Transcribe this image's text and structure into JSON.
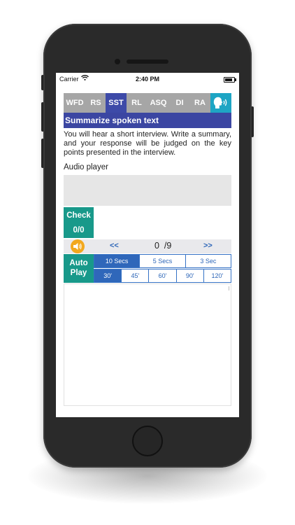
{
  "status_bar": {
    "carrier": "Carrier",
    "time": "2:40 PM"
  },
  "tabs": [
    {
      "label": "WFD",
      "active": false
    },
    {
      "label": "RS",
      "active": false
    },
    {
      "label": "SST",
      "active": true
    },
    {
      "label": "RL",
      "active": false
    },
    {
      "label": "ASQ",
      "active": false
    },
    {
      "label": "DI",
      "active": false
    },
    {
      "label": "RA",
      "active": false
    }
  ],
  "tab_speech_icon": "speaking-head-icon",
  "section": {
    "title": "Summarize spoken text",
    "instructions": "You will hear a short interview. Write a summary, and your response will be judged on the key points presented in the interview."
  },
  "audio": {
    "label": "Audio player"
  },
  "check": {
    "label": "Check",
    "score": "0/0"
  },
  "navigation": {
    "speaker_icon": "speaker-icon",
    "prev_label": "<<",
    "counter": "0  /9",
    "next_label": ">>"
  },
  "autoplay": {
    "line1": "Auto",
    "line2": "Play"
  },
  "delay_options": [
    {
      "label": "10 Secs",
      "selected": true
    },
    {
      "label": "5 Secs",
      "selected": false
    },
    {
      "label": "3 Sec",
      "selected": false
    }
  ],
  "duration_options": [
    {
      "label": "30'",
      "selected": true
    },
    {
      "label": "45'",
      "selected": false
    },
    {
      "label": "60'",
      "selected": false
    },
    {
      "label": "90'",
      "selected": false
    },
    {
      "label": "120'",
      "selected": false
    }
  ],
  "colors": {
    "tab_bar": "#a6a6a6",
    "tab_active": "#3d4aa8",
    "title_bar": "#3b46a2",
    "teal_button": "#18998a",
    "segment_blue": "#2f67ba",
    "speaker_orange": "#f2a81e",
    "speech_tab": "#1ea5c4"
  }
}
